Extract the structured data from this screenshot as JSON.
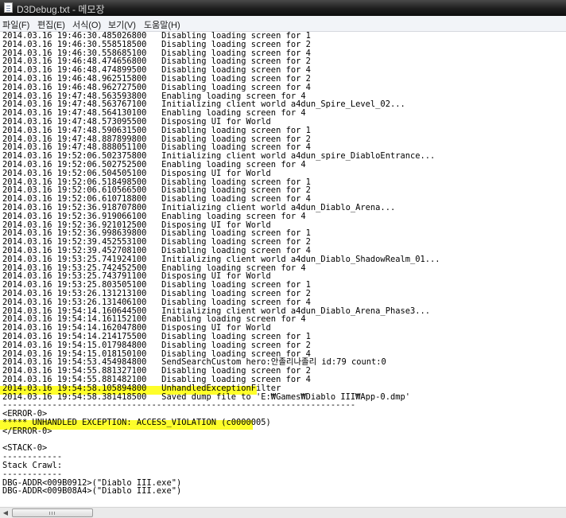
{
  "window": {
    "title": "D3Debug.txt - 메모장"
  },
  "menu": [
    "파일(F)",
    "편집(E)",
    "서식(O)",
    "보기(V)",
    "도움말(H)"
  ],
  "lines": [
    "2014.03.16 19:46:30.485026800   Disabling loading screen for 1",
    "2014.03.16 19:46:30.558518500   Disabling loading screen for 2",
    "2014.03.16 19:46:30.558685100   Disabling loading screen for 4",
    "2014.03.16 19:46:48.474656800   Disabling loading screen for 2",
    "2014.03.16 19:46:48.474899500   Disabling loading screen for 4",
    "2014.03.16 19:46:48.962515800   Disabling loading screen for 2",
    "2014.03.16 19:46:48.962727500   Disabling loading screen for 4",
    "2014.03.16 19:47:48.563593800   Enabling loading screen for 4",
    "2014.03.16 19:47:48.563767100   Initializing client world a4dun_Spire_Level_02...",
    "2014.03.16 19:47:48.564130100   Enabling loading screen for 4",
    "2014.03.16 19:47:48.573095500   Disposing UI for World",
    "2014.03.16 19:47:48.590631500   Disabling loading screen for 1",
    "2014.03.16 19:47:48.887899800   Disabling loading screen for 2",
    "2014.03.16 19:47:48.888051100   Disabling loading screen for 4",
    "2014.03.16 19:52:06.502375800   Initializing client world a4dun_spire_DiabloEntrance...",
    "2014.03.16 19:52:06.502752500   Enabling loading screen for 4",
    "2014.03.16 19:52:06.504505100   Disposing UI for World",
    "2014.03.16 19:52:06.518498500   Disabling loading screen for 1",
    "2014.03.16 19:52:06.610566500   Disabling loading screen for 2",
    "2014.03.16 19:52:06.610718800   Disabling loading screen for 4",
    "2014.03.16 19:52:36.918707800   Initializing client world a4dun_Diablo_Arena...",
    "2014.03.16 19:52:36.919066100   Enabling loading screen for 4",
    "2014.03.16 19:52:36.921012500   Disposing UI for World",
    "2014.03.16 19:52:36.998639800   Disabling loading screen for 1",
    "2014.03.16 19:52:39.452553100   Disabling loading screen for 2",
    "2014.03.16 19:52:39.452708100   Disabling loading screen for 4",
    "2014.03.16 19:53:25.741924100   Initializing client world a4dun_Diablo_ShadowRealm_01...",
    "2014.03.16 19:53:25.742452500   Enabling loading screen for 4",
    "2014.03.16 19:53:25.743791100   Disposing UI for World",
    "2014.03.16 19:53:25.803505100   Disabling loading screen for 1",
    "2014.03.16 19:53:26.131213100   Disabling loading screen for 2",
    "2014.03.16 19:53:26.131406100   Disabling loading screen for 4",
    "2014.03.16 19:54:14.160644500   Initializing client world a4dun_Diablo_Arena_Phase3...",
    "2014.03.16 19:54:14.161152100   Enabling loading screen for 4",
    "2014.03.16 19:54:14.162047800   Disposing UI for World",
    "2014.03.16 19:54:14.214175500   Disabling loading screen for 1",
    "2014.03.16 19:54:15.017984800   Disabling loading screen for 2",
    "2014.03.16 19:54:15.018150100   Disabling loading screen for 4",
    "2014.03.16 19:54:53.454984800   SendSearchCustom hero:안졸리나졸리 id:79 count:0",
    "2014.03.16 19:54:55.881327100   Disabling loading screen for 2",
    "2014.03.16 19:54:55.881482100   Disabling loading screen for 4",
    "2014.03.16 19:54:58.105894800   UnhandledExceptionFilter",
    "2014.03.16 19:54:58.381418500   Saved dump file to 'E:₩Games₩Diablo III₩App-0.dmp'",
    "-----------------------------------------------------------------------",
    "<ERROR-0>",
    "***** UNHANDLED EXCEPTION: ACCESS_VIOLATION (c0000005)",
    "</ERROR-0>",
    "",
    "<STACK-0>",
    "------------",
    "Stack Crawl:",
    "------------",
    "DBG-ADDR<009B0912>(\"Diablo III.exe\")",
    "DBG-ADDR<009B08A4>(\"Diablo III.exe\")"
  ],
  "colors": {
    "highlight": "#fefe2a",
    "text": "#000000"
  },
  "icons": {
    "app": "notepad-icon",
    "scroll_left": "arrow-left-icon"
  }
}
